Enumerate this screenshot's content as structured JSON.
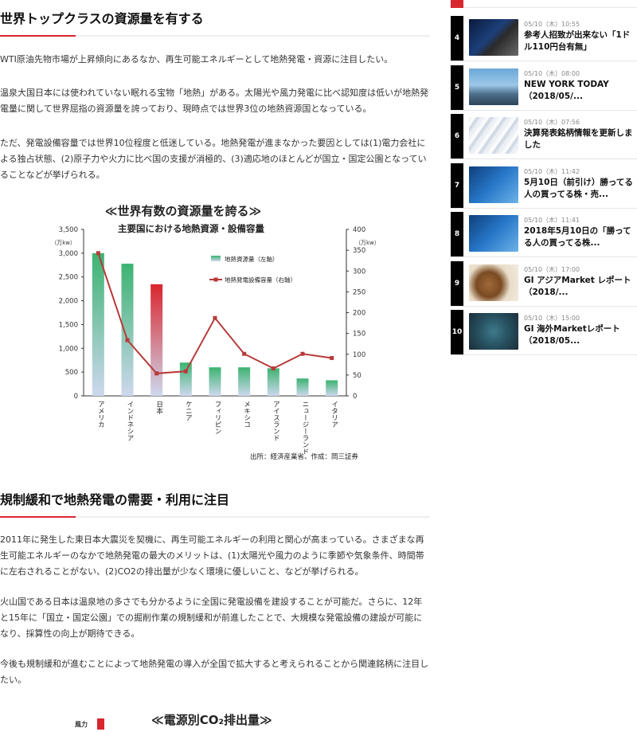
{
  "article": {
    "heading1": "世界トップクラスの資源量を有する",
    "para1": "WTI原油先物市場が上昇傾向にあるなか、再生可能エネルギーとして地熱発電・資源に注目したい。",
    "para2": "温泉大国日本には使われていない眠れる宝物「地熱」がある。太陽光や風力発電に比べ認知度は低いが地熱発電量に関して世界屈指の資源量を誇っており、現時点では世界3位の地熱資源国となっている。",
    "para3": "ただ、発電設備容量では世界10位程度と低迷している。地熱発電が進まなかった要因としては(1)電力会社による独占状態、(2)原子力や火力に比べ国の支援が消極的、(3)適応地のほとんどが国立・国定公園となっていることなどが挙げられる。",
    "heading2": "規制緩和で地熱発電の需要・利用に注目",
    "para4": "2011年に発生した東日本大震災を契機に、再生可能エネルギーの利用と関心が高まっている。さまざまな再生可能エネルギーのなかで地熱発電の最大のメリットは、(1)太陽光や風力のように季節や気象条件、時間帯に左右されることがない、(2)CO2の排出量が少なく環境に優しいこと、などが挙げられる。",
    "para5": "火山国である日本は温泉地の多さでも分かるように全国に発電設備を建設することが可能だ。さらに、12年と15年に「国立・国定公園」での掘削作業の規制緩和が前進したことで、大規模な発電設備の建設が可能になり、採算性の向上が期待できる。",
    "para6": "今後も規制緩和が進むことによって地熱発電の導入が全国で拡大すると考えられることから関連銘柄に注目したい。",
    "next_figure_title": "≪電源別CO₂排出量≫",
    "next_figure_label": "風力"
  },
  "chart_data": {
    "type": "bar",
    "figure_title": "≪世界有数の資源量を誇る≫",
    "title": "主要国における地熱資源・設備容量",
    "categories": [
      "アメリカ",
      "インドネシア",
      "日本",
      "ケニア",
      "フィリピン",
      "メキシコ",
      "アイスランド",
      "ニュージーランド",
      "イタリア"
    ],
    "series": [
      {
        "name": "地熱資源量（左軸）",
        "type": "bar",
        "axis": "left",
        "values": [
          3000,
          2779,
          2347,
          700,
          600,
          600,
          580,
          365,
          327
        ]
      },
      {
        "name": "地熱発電設備容量（右軸）",
        "type": "line",
        "axis": "right",
        "values": [
          343,
          134,
          54,
          59,
          187,
          101,
          66,
          101,
          91
        ]
      }
    ],
    "left_axis": {
      "unit": "（万kw）",
      "ylim": [
        0,
        3500
      ],
      "ticks": [
        "0",
        "500",
        "1,000",
        "1,500",
        "2,000",
        "2,500",
        "3,000",
        "3,500"
      ]
    },
    "right_axis": {
      "unit": "（万kw）",
      "ylim": [
        0,
        400
      ],
      "ticks": [
        "0",
        "50",
        "100",
        "150",
        "200",
        "250",
        "300",
        "350",
        "400"
      ]
    },
    "highlight_category": "日本",
    "source": "出所：経済産業省、作成：岡三証券",
    "colors": {
      "bar_top": "#3cb371",
      "bar_bottom": "#cdd8ee",
      "japan_top": "#d9262e",
      "line": "#b83a3a"
    }
  },
  "sidebar": {
    "items": [
      {
        "rank": "4",
        "date": "05/10（木）10:55",
        "title": "参考人招致が出来ない「1ドル110円台有無」",
        "thumb": "fx"
      },
      {
        "rank": "5",
        "date": "05/10（木）08:00",
        "title": "NEW YORK TODAY（2018/05/...",
        "thumb": "ny"
      },
      {
        "rank": "6",
        "date": "05/10（木）07:56",
        "title": "決算発表銘柄情報を更新しました",
        "thumb": "paper"
      },
      {
        "rank": "7",
        "date": "05/10（木）11:42",
        "title": "5月10日（前引け）勝ってる人の買ってる株・売...",
        "thumb": "blue"
      },
      {
        "rank": "8",
        "date": "05/10（木）11:41",
        "title": "2018年5月10日の「勝ってる人の買ってる株...",
        "thumb": "blue"
      },
      {
        "rank": "9",
        "date": "05/10（木）17:00",
        "title": "GI アジアMarket レポート（2018/...",
        "thumb": "globe"
      },
      {
        "rank": "10",
        "date": "05/10（木）15:00",
        "title": "GI 海外Marketレポート（2018/05...",
        "thumb": "network"
      }
    ]
  }
}
